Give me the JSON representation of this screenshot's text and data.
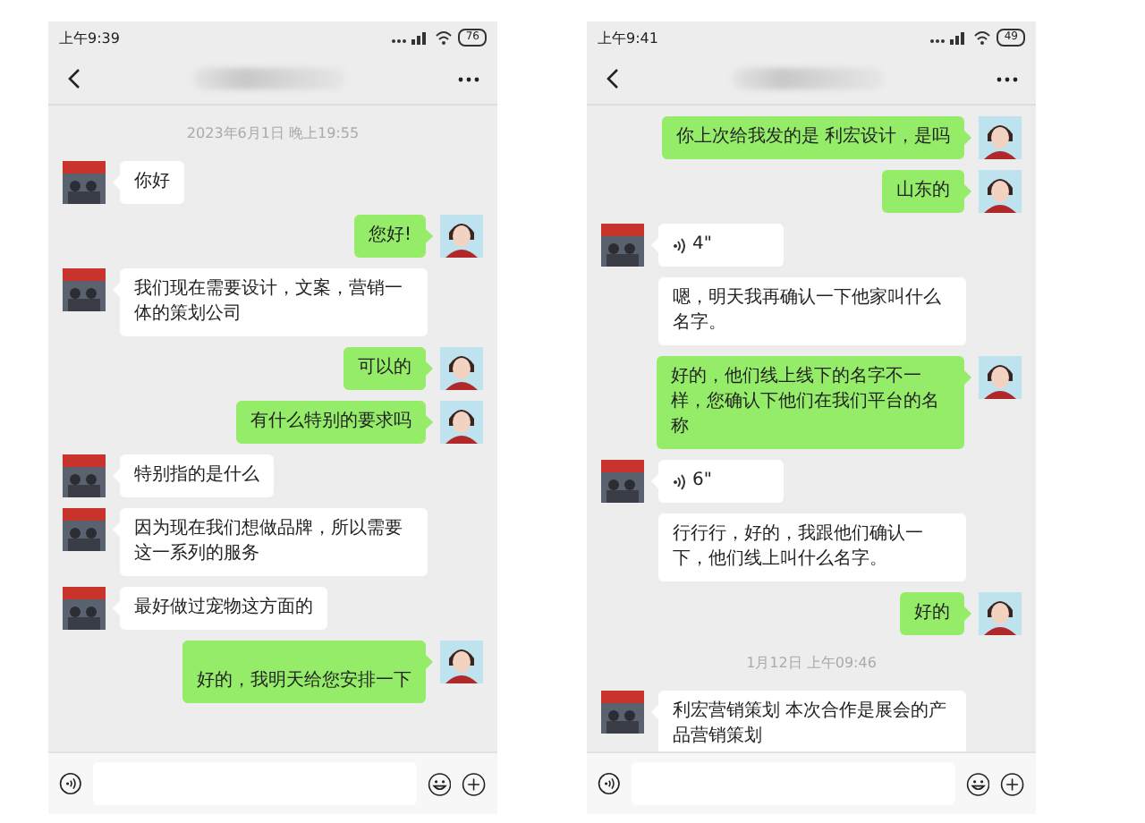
{
  "phones": [
    {
      "status_time": "上午9:39",
      "battery": "76",
      "messages": [
        {
          "kind": "time",
          "text": "2023年6月1日 晚上19:55"
        },
        {
          "kind": "text",
          "outgoing": false,
          "avatar": true,
          "text": "你好"
        },
        {
          "kind": "text",
          "outgoing": true,
          "avatar": true,
          "text": "您好!"
        },
        {
          "kind": "text",
          "outgoing": false,
          "avatar": true,
          "text": "我们现在需要设计，文案，营销一体的策划公司"
        },
        {
          "kind": "text",
          "outgoing": true,
          "avatar": true,
          "text": "可以的"
        },
        {
          "kind": "text",
          "outgoing": true,
          "avatar": true,
          "text": "有什么特别的要求吗"
        },
        {
          "kind": "text",
          "outgoing": false,
          "avatar": true,
          "text": "特别指的是什么"
        },
        {
          "kind": "text",
          "outgoing": false,
          "avatar": true,
          "text": "因为现在我们想做品牌，所以需要这一系列的服务"
        },
        {
          "kind": "text",
          "outgoing": false,
          "avatar": true,
          "text": "最好做过宠物这方面的"
        },
        {
          "kind": "text",
          "outgoing": true,
          "avatar": true,
          "tall": true,
          "text": "好的，我明天给您安排一下"
        }
      ]
    },
    {
      "status_time": "上午9:41",
      "battery": "49",
      "messages": [
        {
          "kind": "text",
          "outgoing": true,
          "avatar": true,
          "text": "你上次给我发的是 利宏设计，是吗"
        },
        {
          "kind": "text",
          "outgoing": true,
          "avatar": true,
          "text": "山东的"
        },
        {
          "kind": "voice",
          "outgoing": false,
          "avatar": true,
          "text": "4\""
        },
        {
          "kind": "text",
          "outgoing": false,
          "avatar": false,
          "text": "嗯，明天我再确认一下他家叫什么名字。"
        },
        {
          "kind": "text",
          "outgoing": true,
          "avatar": true,
          "text": "好的，他们线上线下的名字不一样，您确认下他们在我们平台的名称"
        },
        {
          "kind": "voice",
          "outgoing": false,
          "avatar": true,
          "text": "6\""
        },
        {
          "kind": "text",
          "outgoing": false,
          "avatar": false,
          "text": "行行行，好的，我跟他们确认一下，他们线上叫什么名字。"
        },
        {
          "kind": "text",
          "outgoing": true,
          "avatar": true,
          "text": "好的"
        },
        {
          "kind": "time",
          "text": "1月12日 上午09:46"
        },
        {
          "kind": "text",
          "outgoing": false,
          "avatar": true,
          "text": "利宏营销策划  本次合作是展会的产品营销策划"
        }
      ]
    }
  ]
}
